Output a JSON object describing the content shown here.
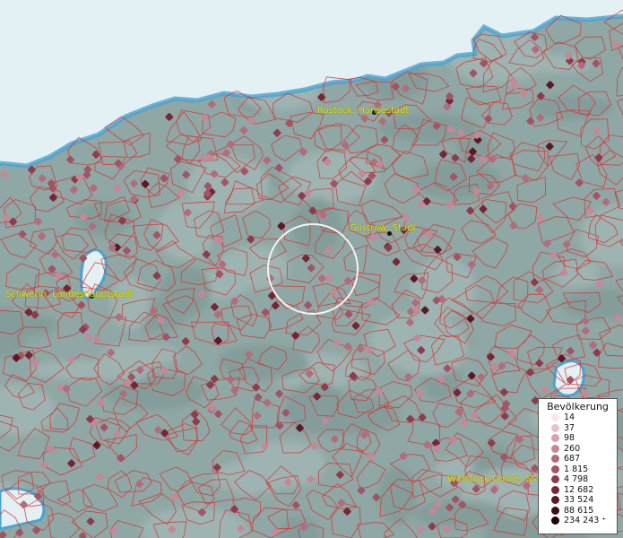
{
  "map": {
    "cities": [
      {
        "label": "Rostock, Hansestadt"
      },
      {
        "label": "Güstrow, Stadt"
      },
      {
        "label": "Schwerin, Landeshauptstadt"
      },
      {
        "label": "Wittstock/Dosse, Sta"
      }
    ],
    "colors": {
      "land": "#8fa7a5",
      "sea": "#e3f0f4",
      "coast": "#4ba3d1",
      "borders": "#d8302e"
    }
  },
  "legend": {
    "title": "Bevölkerung",
    "items": [
      {
        "label": "14",
        "color": "#f6e8ee"
      },
      {
        "label": "37",
        "color": "#e6c3cd"
      },
      {
        "label": "98",
        "color": "#d4a2b0"
      },
      {
        "label": "260",
        "color": "#c58897"
      },
      {
        "label": "687",
        "color": "#b36c7c"
      },
      {
        "label": "1 815",
        "color": "#a35464"
      },
      {
        "label": "4 798",
        "color": "#8e3c4c"
      },
      {
        "label": "12 682",
        "color": "#762636"
      },
      {
        "label": "33 524",
        "color": "#5c1826"
      },
      {
        "label": "88 615",
        "color": "#3e0c16"
      },
      {
        "label": "234 243 ⁺",
        "color": "#1a0308"
      }
    ]
  }
}
